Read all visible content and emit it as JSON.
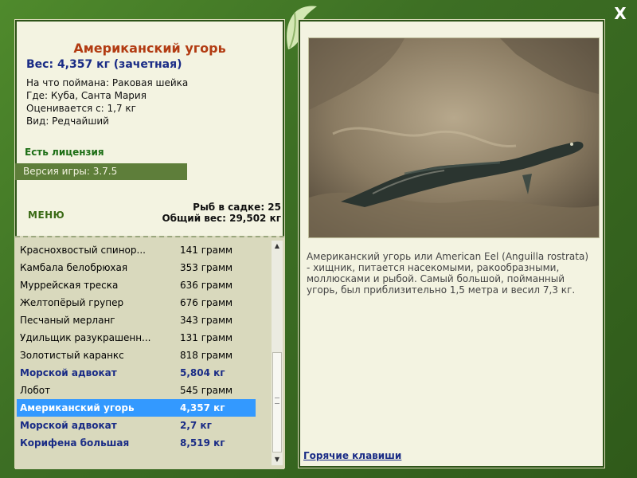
{
  "window": {
    "close_label": "X"
  },
  "fish": {
    "name": "Американский угорь",
    "weight_line": "Вес: 4,357 кг (зачетная)",
    "caught_on": "На что поймана: Раковая шейка",
    "location": "Где: Куба, Санта Мария",
    "valued_from": "Оценивается с: 1,7 кг",
    "rarity": "Вид: Редчайший",
    "description": "Американский угорь или American Eel (Anguilla rostrata) - хищник, питается насекомыми, ракообразными, моллюсками и рыбой. Самый большой, пойманный угорь, был приблизительно 1,5 метра и весил 7,3 кг."
  },
  "license": "Есть лицензия",
  "version": "Версия игры: 3.7.5",
  "menu_label": "МЕНЮ",
  "keep": {
    "count": "Рыб в садке: 25",
    "total": "Общий вес: 29,502 кг"
  },
  "catch_list": [
    {
      "name": "Краснохвостый спинор...",
      "weight": "141 грамм",
      "big": false,
      "selected": false
    },
    {
      "name": "Камбала белобрюхая",
      "weight": "353 грамм",
      "big": false,
      "selected": false
    },
    {
      "name": "Муррейская треска",
      "weight": "636 грамм",
      "big": false,
      "selected": false
    },
    {
      "name": "Желтопёрый групер",
      "weight": "676 грамм",
      "big": false,
      "selected": false
    },
    {
      "name": "Песчаный мерланг",
      "weight": "343 грамм",
      "big": false,
      "selected": false
    },
    {
      "name": "Удильщик разукрашенн...",
      "weight": "131 грамм",
      "big": false,
      "selected": false
    },
    {
      "name": "Золотистый каранкс",
      "weight": "818 грамм",
      "big": false,
      "selected": false
    },
    {
      "name": "Морской адвокат",
      "weight": "5,804 кг",
      "big": true,
      "selected": false
    },
    {
      "name": "Лобот",
      "weight": "545 грамм",
      "big": false,
      "selected": false
    },
    {
      "name": "Американский угорь",
      "weight": "4,357 кг",
      "big": true,
      "selected": true
    },
    {
      "name": "Морской адвокат",
      "weight": "2,7 кг",
      "big": true,
      "selected": false
    },
    {
      "name": "Корифена большая",
      "weight": "8,519 кг",
      "big": true,
      "selected": false
    }
  ],
  "hotkeys_label": "Горячие клавиши",
  "colors": {
    "frame": "#3d6f24",
    "panel": "#f3f3e1",
    "title": "#b23b12",
    "accent": "#1a2c86",
    "selection": "#3399ff"
  }
}
